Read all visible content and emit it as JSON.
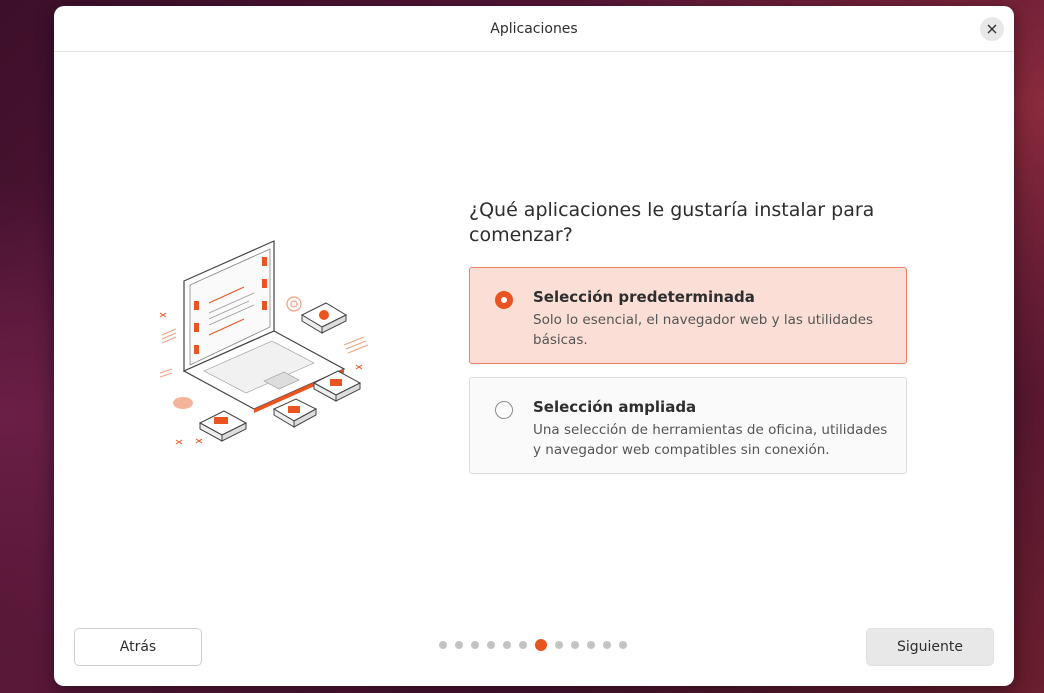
{
  "window": {
    "title": "Aplicaciones"
  },
  "question": "¿Qué aplicaciones le gustaría instalar para comenzar?",
  "options": [
    {
      "title": "Selección predeterminada",
      "description": "Solo lo esencial, el navegador web y las utilidades básicas.",
      "selected": true
    },
    {
      "title": "Selección ampliada",
      "description": "Una selección de herramientas de oficina, utilidades y navegador web compatibles sin conexión.",
      "selected": false
    }
  ],
  "navigation": {
    "back_label": "Atrás",
    "next_label": "Siguiente",
    "progress": {
      "total_steps": 12,
      "current_step": 7
    }
  },
  "colors": {
    "accent": "#e95420",
    "selected_bg": "#fbdfd6"
  },
  "icons": {
    "close": "close-icon",
    "illustration": "laptop-apps-illustration"
  }
}
